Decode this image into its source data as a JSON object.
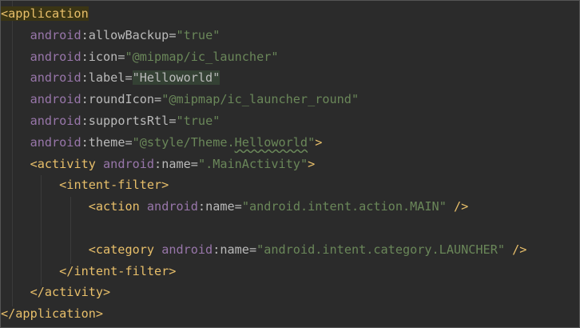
{
  "code": {
    "application_open": "<application",
    "allowBackup": {
      "ns": "android",
      "attr": "allowBackup",
      "value": "\"true\""
    },
    "icon": {
      "ns": "android",
      "attr": "icon",
      "value": "\"@mipmap/ic_launcher\""
    },
    "label": {
      "ns": "android",
      "attr": "label",
      "value": "\"Helloworld\""
    },
    "roundIcon": {
      "ns": "android",
      "attr": "roundIcon",
      "value": "\"@mipmap/ic_launcher_round\""
    },
    "supportsRtl": {
      "ns": "android",
      "attr": "supportsRtl",
      "value": "\"true\""
    },
    "theme": {
      "ns": "android",
      "attr": "theme",
      "value_prefix": "\"@style/Theme.",
      "value_word": "Helloworld",
      "value_suffix": "\"",
      "close": ">"
    },
    "activity_open": {
      "tag": "<activity",
      "ns": "android",
      "attr": "name",
      "value": "\".MainActivity\"",
      "close": ">"
    },
    "intent_filter_open": "<intent-filter>",
    "action": {
      "tag": "<action",
      "ns": "android",
      "attr": "name",
      "value": "\"android.intent.action.MAIN\"",
      "close": "/>"
    },
    "category": {
      "tag": "<category",
      "ns": "android",
      "attr": "name",
      "value": "\"android.intent.category.LAUNCHER\"",
      "close": "/>"
    },
    "intent_filter_close": "</intent-filter>",
    "activity_close": "</activity>",
    "application_close": "</application>"
  },
  "colors": {
    "background": "#2b2b2b",
    "tag": "#e8bf6a",
    "namespace": "#9876aa",
    "attribute": "#bababa",
    "string": "#6a8759"
  }
}
